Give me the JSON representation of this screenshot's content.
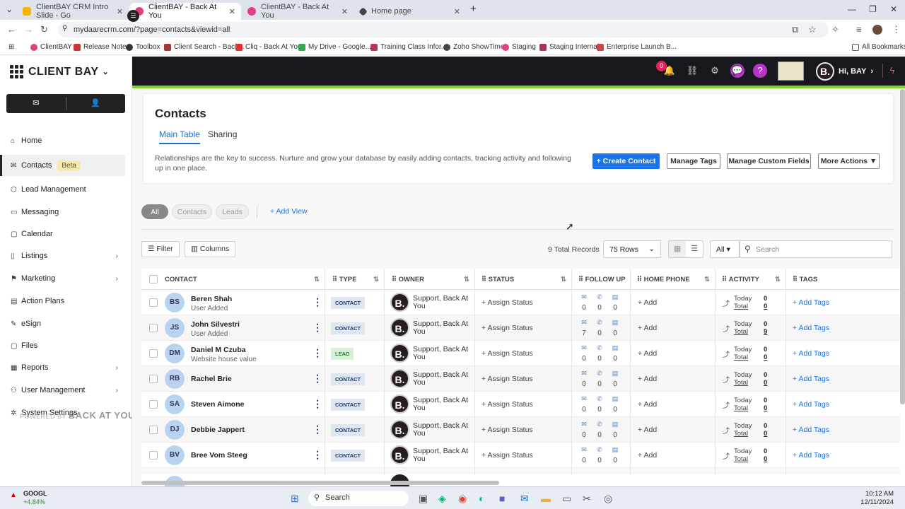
{
  "browser": {
    "tabs": [
      {
        "title": "ClientBAY CRM Intro Slide - Go",
        "color": "#f4b400"
      },
      {
        "title": "ClientBAY - Back At You",
        "color": "#e04080",
        "active": true
      },
      {
        "title": "ClientBAY - Back At You",
        "color": "#e04080"
      },
      {
        "title": "Home page",
        "color": "#444"
      }
    ],
    "url": "mydaarecrm.com/?page=contacts&viewid=all",
    "bookmarks": [
      "ClientBAY",
      "Release Notes",
      "Toolbox",
      "Client Search - Back...",
      "Cliq - Back At You",
      "My Drive - Google...",
      "Training Class Infor...",
      "Zoho ShowTime",
      "Staging",
      "Staging Internal",
      "Enterprise Launch B...",
      "All Bookmarks"
    ]
  },
  "app": {
    "logo": "CLIENT BAY",
    "notif_count": "0",
    "greeting": "Hi, BAY",
    "avatar_letter": "B."
  },
  "sidebar": {
    "items": [
      {
        "label": "Home",
        "icon": "home-icon"
      },
      {
        "label": "Contacts",
        "icon": "contacts-icon",
        "badge": "Beta",
        "active": true
      },
      {
        "label": "Lead Management",
        "icon": "lead-icon"
      },
      {
        "label": "Messaging",
        "icon": "messaging-icon"
      },
      {
        "label": "Calendar",
        "icon": "calendar-icon"
      },
      {
        "label": "Listings",
        "icon": "listings-icon",
        "arrow": true
      },
      {
        "label": "Marketing",
        "icon": "marketing-icon",
        "arrow": true
      },
      {
        "label": "Action Plans",
        "icon": "action-plans-icon"
      },
      {
        "label": "eSign",
        "icon": "esign-icon"
      },
      {
        "label": "Files",
        "icon": "files-icon"
      },
      {
        "label": "Reports",
        "icon": "reports-icon",
        "arrow": true
      },
      {
        "label": "User Management",
        "icon": "user-management-icon",
        "arrow": true
      },
      {
        "label": "System Settings",
        "icon": "settings-icon"
      }
    ],
    "powered_by": "POWERED BY",
    "powered_brand": "BACK AT YOU!"
  },
  "page": {
    "title": "Contacts",
    "tabs": [
      "Main Table",
      "Sharing"
    ],
    "description": "Relationships are the key to success. Nurture and grow your database by easily adding contacts, tracking activity and following up in one place.",
    "buttons": {
      "create": "+ Create Contact",
      "tags": "Manage Tags",
      "fields": "Manage Custom Fields",
      "more": "More Actions ▼"
    },
    "views": [
      "All",
      "Contacts",
      "Leads"
    ],
    "add_view": "+ Add View",
    "filter": "Filter",
    "columns_btn": "Columns",
    "total": "9 Total Records",
    "rows": "75 Rows",
    "all": "All",
    "search_placeholder": "Search"
  },
  "table": {
    "headers": [
      "CONTACT",
      "TYPE",
      "OWNER",
      "STATUS",
      "FOLLOW UP",
      "HOME PHONE",
      "ACTIVITY",
      "TAGS"
    ],
    "owner": "Support, Back At You",
    "assign": "+ Assign Status",
    "add": "+ Add",
    "add_tags": "+ Add Tags",
    "today": "Today",
    "total_lbl": "Total",
    "rows": [
      {
        "initials": "BS",
        "name": "Beren Shah",
        "sub": "User Added",
        "type": "CONTACT",
        "fu": [
          "0",
          "0",
          "0"
        ],
        "today": "0",
        "total": "0"
      },
      {
        "initials": "JS",
        "name": "John Silvestri",
        "sub": "User Added",
        "type": "CONTACT",
        "fu": [
          "7",
          "0",
          "0"
        ],
        "today": "0",
        "total": "9"
      },
      {
        "initials": "DM",
        "name": "Daniel M Czuba",
        "sub": "Website house value",
        "type": "LEAD",
        "fu": [
          "0",
          "0",
          "0"
        ],
        "today": "0",
        "total": "0"
      },
      {
        "initials": "RB",
        "name": "Rachel Brie",
        "sub": "",
        "type": "CONTACT",
        "fu": [
          "0",
          "0",
          "0"
        ],
        "today": "0",
        "total": "0"
      },
      {
        "initials": "SA",
        "name": "Steven Aimone",
        "sub": "",
        "type": "CONTACT",
        "fu": [
          "0",
          "0",
          "0"
        ],
        "today": "0",
        "total": "0"
      },
      {
        "initials": "DJ",
        "name": "Debbie Jappert",
        "sub": "",
        "type": "CONTACT",
        "fu": [
          "0",
          "0",
          "0"
        ],
        "today": "0",
        "total": "0"
      },
      {
        "initials": "BV",
        "name": "Bree Vom Steeg",
        "sub": "",
        "type": "CONTACT",
        "fu": [
          "0",
          "0",
          "0"
        ],
        "today": "0",
        "total": "0"
      }
    ]
  },
  "taskbar": {
    "ticker": "GOOGL",
    "ticker_change": "+4.84%",
    "search": "Search",
    "time": "10:12 AM",
    "date": "12/11/2024"
  }
}
